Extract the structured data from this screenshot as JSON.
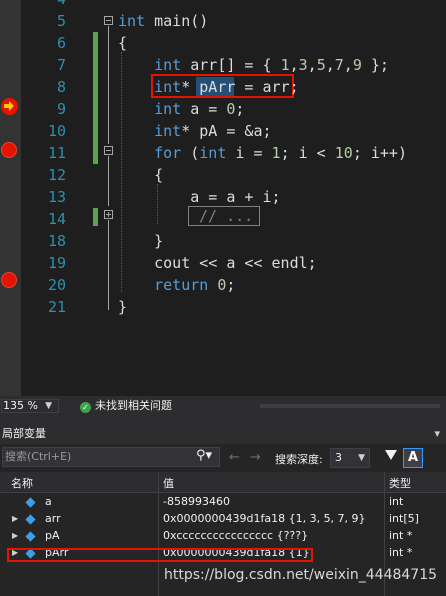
{
  "editor": {
    "lines": [
      {
        "num": "4"
      },
      {
        "num": "5",
        "text": "int main()"
      },
      {
        "num": "6",
        "text": "{"
      },
      {
        "num": "7",
        "text": "    int arr[] = { 1,3,5,7,9 };"
      },
      {
        "num": "8",
        "text": "    int* pArr = arr;"
      },
      {
        "num": "9",
        "text": "    int a = 0;"
      },
      {
        "num": "10",
        "text": "    int* pA = &a;"
      },
      {
        "num": "11",
        "text": "    for (int i = 1; i < 10; i++)"
      },
      {
        "num": "12",
        "text": "    {"
      },
      {
        "num": "13",
        "text": "        a = a + i;"
      },
      {
        "num": "14",
        "text": "// ..."
      },
      {
        "num": "18",
        "text": "    }"
      },
      {
        "num": "19",
        "text": "    cout << a << endl;"
      },
      {
        "num": "20",
        "text": "    return 0;"
      },
      {
        "num": "21",
        "text": "}"
      }
    ],
    "breakpoint_lines": [
      "11",
      "20"
    ],
    "current_line": "9"
  },
  "status": {
    "zoom": "135 %",
    "issues": "未找到相关问题"
  },
  "locals": {
    "title": "局部变量",
    "search_placeholder": "搜索(Ctrl+E)",
    "depth_label": "搜索深度:",
    "depth_value": "3",
    "filter_aa": "A",
    "columns": {
      "name": "名称",
      "value": "值",
      "type": "类型"
    },
    "rows": [
      {
        "name": "a",
        "value": "-858993460",
        "type": "int",
        "expandable": false
      },
      {
        "name": "arr",
        "value": "0x0000000439d1fa18 {1, 3, 5, 7, 9}",
        "type": "int[5]",
        "expandable": true
      },
      {
        "name": "pA",
        "value": "0xcccccccccccccccc {???}",
        "type": "int *",
        "expandable": true
      },
      {
        "name": "pArr",
        "value": "0x0000000439d1fa18 {1}",
        "type": "int *",
        "expandable": true
      }
    ]
  },
  "watermark": "https://blog.csdn.net/weixin_44484715",
  "colors": {
    "keyword": "#569cd6",
    "number": "#b5cea8",
    "line_number": "#2b91af",
    "breakpoint": "#e51400",
    "highlight_box": "#e51400"
  }
}
